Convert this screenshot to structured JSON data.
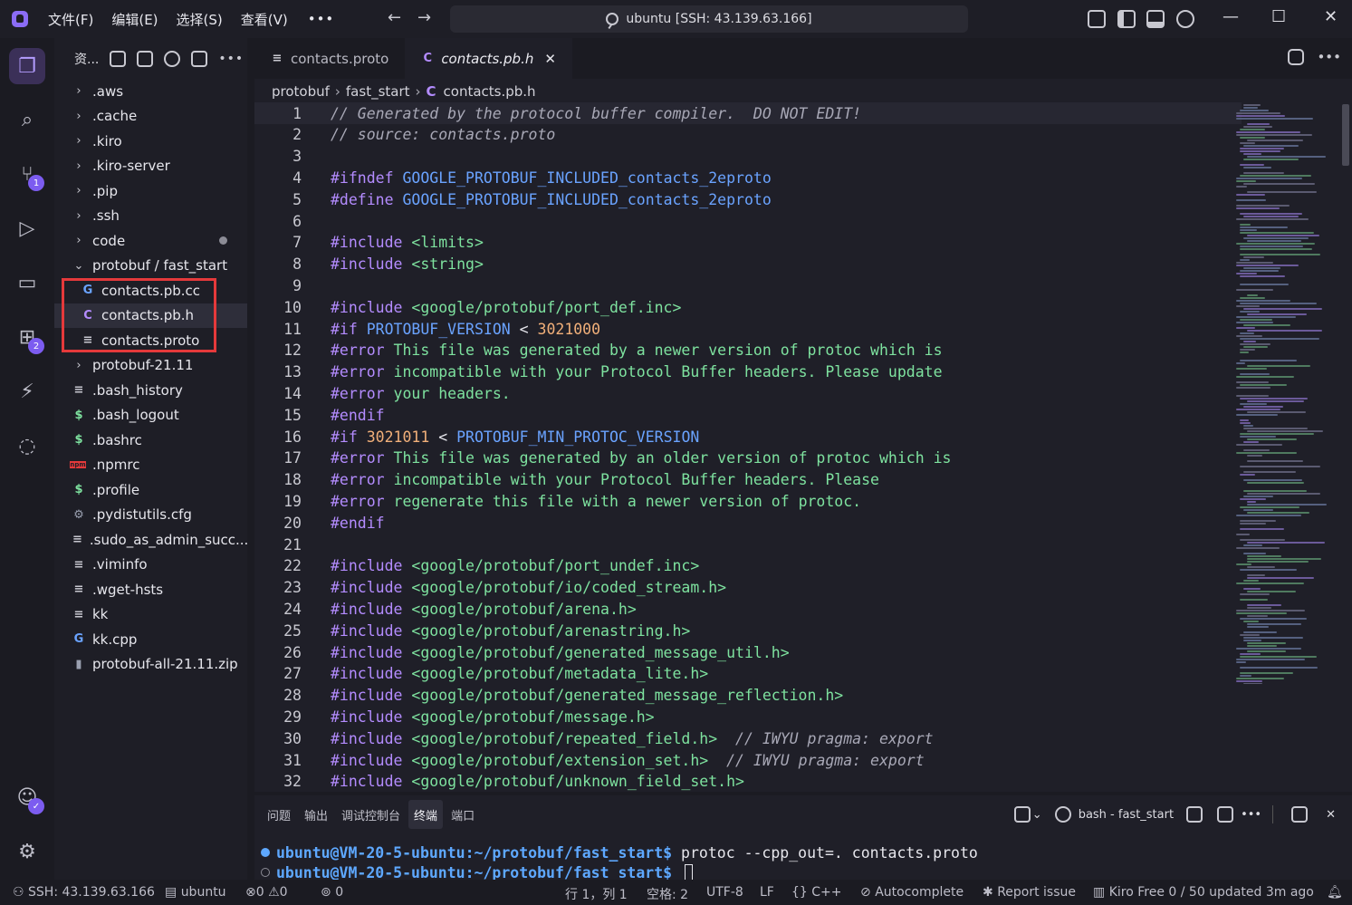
{
  "titlebar": {
    "menus": [
      "文件(F)",
      "编辑(E)",
      "选择(S)",
      "查看(V)"
    ],
    "more": "•••",
    "back": "←",
    "forward": "→",
    "search_label": "ubuntu [SSH: 43.139.63.166]",
    "minimize": "—",
    "maximize": "☐",
    "close": "✕"
  },
  "activity": {
    "scm_badge": "1",
    "ext_badge": "2"
  },
  "sidebar": {
    "title": "资...",
    "more": "•••",
    "items": [
      {
        "label": ".aws",
        "kind": "folder",
        "icon": "chevron-right-icon",
        "glyph": "›",
        "color": "#c8c8d0"
      },
      {
        "label": ".cache",
        "kind": "folder",
        "icon": "chevron-right-icon",
        "glyph": "›",
        "color": "#c8c8d0"
      },
      {
        "label": ".kiro",
        "kind": "folder",
        "icon": "chevron-right-icon",
        "glyph": "›",
        "color": "#c8c8d0"
      },
      {
        "label": ".kiro-server",
        "kind": "folder",
        "icon": "chevron-right-icon",
        "glyph": "›",
        "color": "#c8c8d0"
      },
      {
        "label": ".pip",
        "kind": "folder",
        "icon": "chevron-right-icon",
        "glyph": "›",
        "color": "#c8c8d0"
      },
      {
        "label": ".ssh",
        "kind": "folder",
        "icon": "chevron-right-icon",
        "glyph": "›",
        "color": "#c8c8d0"
      },
      {
        "label": "code",
        "kind": "folder",
        "icon": "chevron-right-icon",
        "glyph": "›",
        "color": "#c8c8d0"
      },
      {
        "label": "protobuf / fast_start",
        "kind": "folder-open",
        "icon": "chevron-down-icon",
        "glyph": "⌄",
        "color": "#c8c8d0"
      },
      {
        "label": "contacts.pb.cc",
        "kind": "file",
        "icon": "cpp-file-icon",
        "glyph": "G",
        "color": "#6aa3ff"
      },
      {
        "label": "contacts.pb.h",
        "kind": "file",
        "icon": "c-header-file-icon",
        "glyph": "C",
        "color": "#b48cff"
      },
      {
        "label": "contacts.proto",
        "kind": "file",
        "icon": "text-file-icon",
        "glyph": "≡",
        "color": "#c8c8d0"
      },
      {
        "label": "protobuf-21.11",
        "kind": "folder",
        "icon": "chevron-right-icon",
        "glyph": "›",
        "color": "#c8c8d0"
      },
      {
        "label": ".bash_history",
        "kind": "file",
        "icon": "text-file-icon",
        "glyph": "≡",
        "color": "#c8c8d0"
      },
      {
        "label": ".bash_logout",
        "kind": "file",
        "icon": "shell-file-icon",
        "glyph": "$",
        "color": "#7ee29f"
      },
      {
        "label": ".bashrc",
        "kind": "file",
        "icon": "shell-file-icon",
        "glyph": "$",
        "color": "#7ee29f"
      },
      {
        "label": ".npmrc",
        "kind": "file",
        "icon": "npm-file-icon",
        "glyph": "npm",
        "color": "#e5393b"
      },
      {
        "label": ".profile",
        "kind": "file",
        "icon": "shell-file-icon",
        "glyph": "$",
        "color": "#7ee29f"
      },
      {
        "label": ".pydistutils.cfg",
        "kind": "file",
        "icon": "gear-file-icon",
        "glyph": "⚙",
        "color": "#9aa0b0"
      },
      {
        "label": ".sudo_as_admin_succ...",
        "kind": "file",
        "icon": "text-file-icon",
        "glyph": "≡",
        "color": "#c8c8d0"
      },
      {
        "label": ".viminfo",
        "kind": "file",
        "icon": "text-file-icon",
        "glyph": "≡",
        "color": "#c8c8d0"
      },
      {
        "label": ".wget-hsts",
        "kind": "file",
        "icon": "text-file-icon",
        "glyph": "≡",
        "color": "#c8c8d0"
      },
      {
        "label": "kk",
        "kind": "file",
        "icon": "text-file-icon",
        "glyph": "≡",
        "color": "#c8c8d0"
      },
      {
        "label": "kk.cpp",
        "kind": "file",
        "icon": "cpp-file-icon",
        "glyph": "G",
        "color": "#6aa3ff"
      },
      {
        "label": "protobuf-all-21.11.zip",
        "kind": "file",
        "icon": "zip-file-icon",
        "glyph": "▮",
        "color": "#9aa0b0"
      }
    ]
  },
  "editor": {
    "tabs": [
      {
        "label": "contacts.proto",
        "glyph": "≡",
        "active": false
      },
      {
        "label": "contacts.pb.h",
        "glyph": "C",
        "active": true
      }
    ],
    "tab_close": "✕",
    "more": "•••",
    "breadcrumb": [
      "protobuf",
      "fast_start",
      "contacts.pb.h"
    ],
    "breadcrumb_sep": "›",
    "lines": [
      [
        [
          "c-com",
          "// Generated by the protocol buffer compiler.  DO NOT EDIT!"
        ]
      ],
      [
        [
          "c-com",
          "// source: contacts.proto"
        ]
      ],
      [],
      [
        [
          "c-pp",
          "#ifndef "
        ],
        [
          "c-mac",
          "GOOGLE_PROTOBUF_INCLUDED_contacts_2eproto"
        ]
      ],
      [
        [
          "c-pp",
          "#define "
        ],
        [
          "c-mac",
          "GOOGLE_PROTOBUF_INCLUDED_contacts_2eproto"
        ]
      ],
      [],
      [
        [
          "c-pp",
          "#include "
        ],
        [
          "c-str",
          "<limits>"
        ]
      ],
      [
        [
          "c-pp",
          "#include "
        ],
        [
          "c-str",
          "<string>"
        ]
      ],
      [],
      [
        [
          "c-pp",
          "#include "
        ],
        [
          "c-str",
          "<google/protobuf/port_def.inc>"
        ]
      ],
      [
        [
          "c-pp",
          "#if "
        ],
        [
          "c-mac",
          "PROTOBUF_VERSION"
        ],
        [
          "c-op",
          " < "
        ],
        [
          "c-num",
          "3021000"
        ]
      ],
      [
        [
          "c-pp",
          "#error "
        ],
        [
          "c-str",
          "This file was generated by a newer version of protoc which is"
        ]
      ],
      [
        [
          "c-pp",
          "#error "
        ],
        [
          "c-str",
          "incompatible with your Protocol Buffer headers. Please update"
        ]
      ],
      [
        [
          "c-pp",
          "#error "
        ],
        [
          "c-str",
          "your headers."
        ]
      ],
      [
        [
          "c-pp",
          "#endif"
        ]
      ],
      [
        [
          "c-pp",
          "#if "
        ],
        [
          "c-num",
          "3021011"
        ],
        [
          "c-op",
          " < "
        ],
        [
          "c-mac",
          "PROTOBUF_MIN_PROTOC_VERSION"
        ]
      ],
      [
        [
          "c-pp",
          "#error "
        ],
        [
          "c-str",
          "This file was generated by an older version of protoc which is"
        ]
      ],
      [
        [
          "c-pp",
          "#error "
        ],
        [
          "c-str",
          "incompatible with your Protocol Buffer headers. Please"
        ]
      ],
      [
        [
          "c-pp",
          "#error "
        ],
        [
          "c-str",
          "regenerate this file with a newer version of protoc."
        ]
      ],
      [
        [
          "c-pp",
          "#endif"
        ]
      ],
      [],
      [
        [
          "c-pp",
          "#include "
        ],
        [
          "c-str",
          "<google/protobuf/port_undef.inc>"
        ]
      ],
      [
        [
          "c-pp",
          "#include "
        ],
        [
          "c-str",
          "<google/protobuf/io/coded_stream.h>"
        ]
      ],
      [
        [
          "c-pp",
          "#include "
        ],
        [
          "c-str",
          "<google/protobuf/arena.h>"
        ]
      ],
      [
        [
          "c-pp",
          "#include "
        ],
        [
          "c-str",
          "<google/protobuf/arenastring.h>"
        ]
      ],
      [
        [
          "c-pp",
          "#include "
        ],
        [
          "c-str",
          "<google/protobuf/generated_message_util.h>"
        ]
      ],
      [
        [
          "c-pp",
          "#include "
        ],
        [
          "c-str",
          "<google/protobuf/metadata_lite.h>"
        ]
      ],
      [
        [
          "c-pp",
          "#include "
        ],
        [
          "c-str",
          "<google/protobuf/generated_message_reflection.h>"
        ]
      ],
      [
        [
          "c-pp",
          "#include "
        ],
        [
          "c-str",
          "<google/protobuf/message.h>"
        ]
      ],
      [
        [
          "c-pp",
          "#include "
        ],
        [
          "c-str",
          "<google/protobuf/repeated_field.h>"
        ],
        [
          "c-com",
          "  // IWYU pragma: export"
        ]
      ],
      [
        [
          "c-pp",
          "#include "
        ],
        [
          "c-str",
          "<google/protobuf/extension_set.h>"
        ],
        [
          "c-com",
          "  // IWYU pragma: export"
        ]
      ],
      [
        [
          "c-pp",
          "#include "
        ],
        [
          "c-str",
          "<google/protobuf/unknown_field_set.h>"
        ]
      ]
    ]
  },
  "panel": {
    "tabs": [
      "问题",
      "输出",
      "调试控制台",
      "终端",
      "端口"
    ],
    "active_tab": "终端",
    "terminal_label": "bash - fast_start",
    "chevron": "⌄",
    "more": "•••",
    "close": "✕",
    "lines": [
      {
        "prompt": "ubuntu@VM-20-5-ubuntu:~/protobuf/fast_start$",
        "cmd": " protoc --cpp_out=. contacts.proto",
        "dot": "#5ea8ff",
        "cursor": false
      },
      {
        "prompt": "ubuntu@VM-20-5-ubuntu:~/protobuf/fast_start$",
        "cmd": " ",
        "dot": "#8c8c96",
        "cursor": true
      }
    ]
  },
  "statusbar": {
    "remote": "SSH: 43.139.63.166",
    "host": "ubuntu",
    "errors": "0",
    "warnings": "0",
    "ports": "0",
    "position": "行 1，列 1",
    "spaces": "空格: 2",
    "encoding": "UTF-8",
    "eol": "LF",
    "language": "C++",
    "autocomplete": "Autocomplete",
    "report": "Report issue",
    "plan": "Kiro Free 0 / 50 updated 3m ago"
  },
  "colors": {
    "accent": "#7c5cf0",
    "highlight_box": "#e5393b"
  }
}
